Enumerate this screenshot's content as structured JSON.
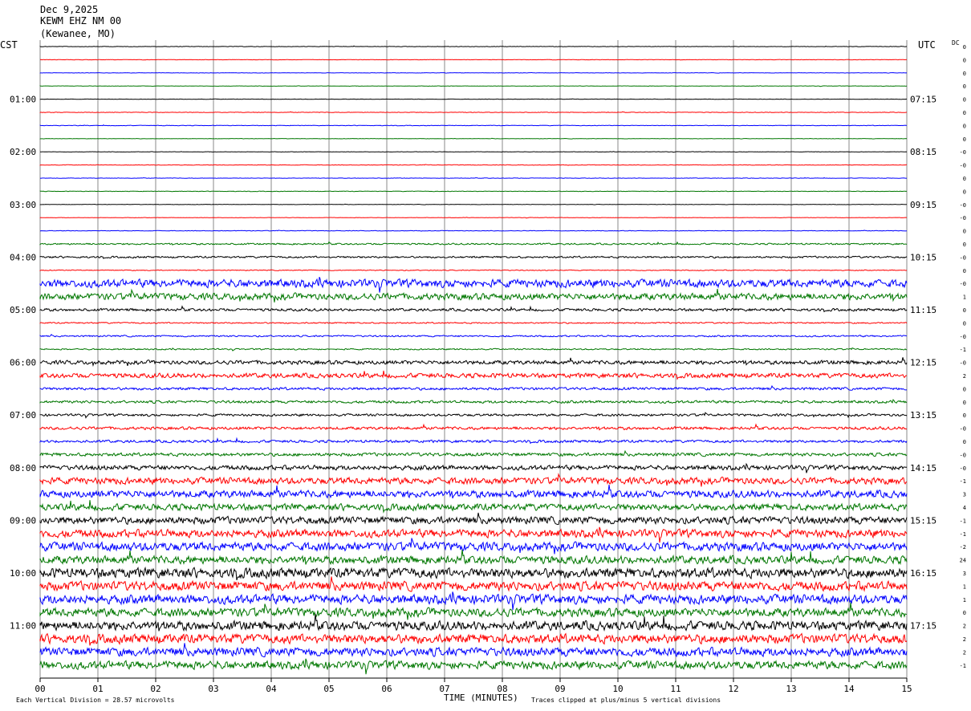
{
  "header": {
    "date": "Dec 9,2025",
    "station": "KEWM EHZ NM 00",
    "location": "(Kewanee, MO)"
  },
  "left_axis_label": "CST",
  "right_axis_label": "UTC",
  "dc_label": "DC",
  "chart_data": {
    "type": "helicorder",
    "rows_per_hour": 4,
    "minutes_per_row": 15,
    "trace_color_cycle": [
      "#000000",
      "#ff0000",
      "#0000ff",
      "#007700"
    ],
    "x_ticks": [
      "00",
      "01",
      "02",
      "03",
      "04",
      "05",
      "06",
      "07",
      "08",
      "09",
      "10",
      "11",
      "12",
      "13",
      "14",
      "15"
    ],
    "x_axis_label": "TIME (MINUTES)",
    "left_hour_labels": [
      {
        "row": 4,
        "label": "01:00"
      },
      {
        "row": 8,
        "label": "02:00"
      },
      {
        "row": 12,
        "label": "03:00"
      },
      {
        "row": 16,
        "label": "04:00"
      },
      {
        "row": 20,
        "label": "05:00"
      },
      {
        "row": 24,
        "label": "06:00"
      },
      {
        "row": 28,
        "label": "07:00"
      },
      {
        "row": 32,
        "label": "08:00"
      },
      {
        "row": 36,
        "label": "09:00"
      },
      {
        "row": 40,
        "label": "10:00"
      },
      {
        "row": 44,
        "label": "11:00"
      }
    ],
    "right_hour_labels": [
      {
        "row": 4,
        "label": "07:15"
      },
      {
        "row": 8,
        "label": "08:15"
      },
      {
        "row": 12,
        "label": "09:15"
      },
      {
        "row": 16,
        "label": "10:15"
      },
      {
        "row": 20,
        "label": "11:15"
      },
      {
        "row": 24,
        "label": "12:15"
      },
      {
        "row": 28,
        "label": "13:15"
      },
      {
        "row": 32,
        "label": "14:15"
      },
      {
        "row": 36,
        "label": "15:15"
      },
      {
        "row": 40,
        "label": "16:15"
      },
      {
        "row": 44,
        "label": "17:15"
      }
    ],
    "dc_offsets": [
      "0",
      "0",
      "0",
      "0",
      "0",
      "0",
      "0",
      "0",
      "-0",
      "-0",
      "0",
      "0",
      "-0",
      "-0",
      "0",
      "0",
      "-0",
      "0",
      "-0",
      "1",
      "0",
      "0",
      "-0",
      "-1",
      "-0",
      "2",
      "0",
      "0",
      "0",
      "-0",
      "0",
      "-0",
      "-0",
      "-1",
      "3",
      "4",
      "-1",
      "-1",
      "-2",
      "24",
      "3",
      "1",
      "1",
      "0",
      "2",
      "2",
      "2",
      "-1"
    ],
    "activity_levels": [
      0.3,
      0.3,
      0.3,
      0.3,
      0.3,
      0.4,
      0.4,
      0.3,
      0.3,
      0.4,
      0.3,
      0.4,
      0.3,
      0.3,
      0.4,
      1.2,
      1.4,
      0.6,
      6.0,
      5.0,
      2.0,
      1.0,
      1.2,
      1.0,
      3.0,
      3.5,
      2.0,
      2.0,
      1.8,
      2.2,
      2.0,
      2.5,
      3.5,
      5.0,
      5.5,
      5.0,
      5.5,
      6.0,
      6.5,
      6.0,
      7.5,
      7.0,
      7.0,
      6.5,
      7.0,
      7.0,
      6.5,
      6.0
    ],
    "footer_left": "Each Vertical Division =   28.57 microvolts",
    "footer_right": "Traces clipped at plus/minus 5 vertical divisions"
  }
}
